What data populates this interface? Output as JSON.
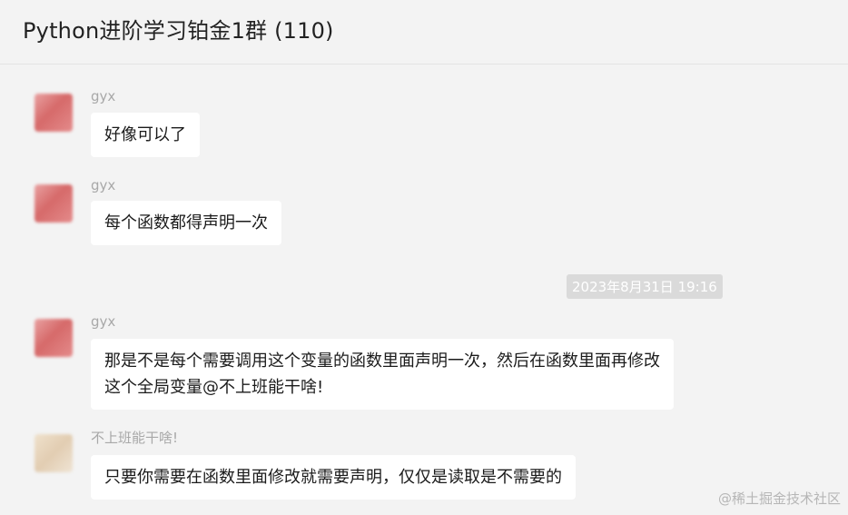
{
  "chat": {
    "title": "Python进阶学习铂金1群 (110)",
    "messages": [
      {
        "sender": "gyx",
        "text": "好像可以了"
      },
      {
        "sender": "gyx",
        "text": "每个函数都得声明一次"
      },
      {
        "sender": "gyx",
        "text": "那是不是每个需要调用这个变量的函数里面声明一次，然后在函数里面再修改\n这个全局变量@不上班能干啥!"
      },
      {
        "sender": "不上班能干啥!",
        "text": "只要你需要在函数里面修改就需要声明，仅仅是读取是不需要的"
      }
    ],
    "timestamp": "2023年8月31日 19:16"
  },
  "watermark": "@稀土掘金技术社区",
  "colors": {
    "background": "#f3f3f3",
    "bubble": "#ffffff",
    "timestamp_bg": "#dadada",
    "sender": "#a8a8a8"
  }
}
